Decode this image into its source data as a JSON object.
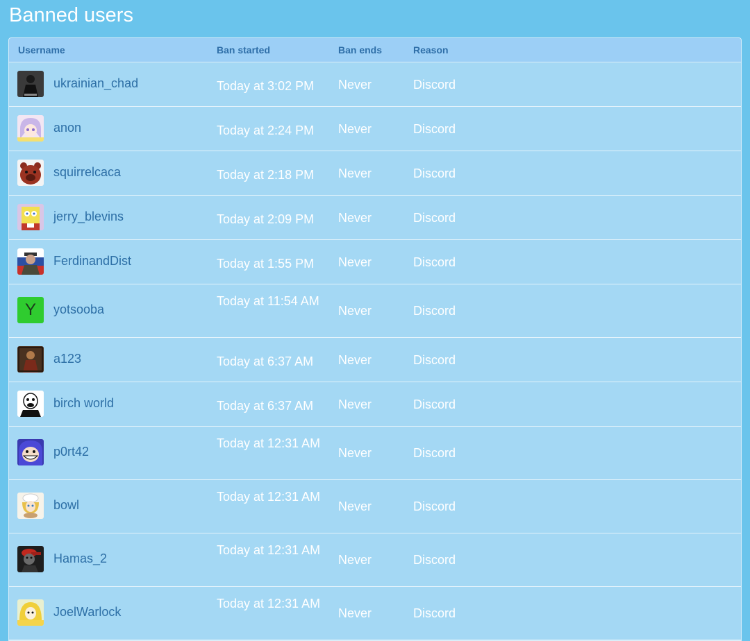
{
  "page": {
    "title": "Banned users"
  },
  "table": {
    "headers": {
      "username": "Username",
      "ban_started": "Ban started",
      "ban_ends": "Ban ends",
      "reason": "Reason"
    },
    "rows": [
      {
        "username": "ukrainian_chad",
        "ban_started": "Today at 3:02 PM",
        "ban_ends": "Never",
        "reason": "Discord",
        "avatar": "dark-figure-avatar"
      },
      {
        "username": "anon",
        "ban_started": "Today at 2:24 PM",
        "ban_ends": "Never",
        "reason": "Discord",
        "avatar": "anime-girl-avatar"
      },
      {
        "username": "squirrelcaca",
        "ban_started": "Today at 2:18 PM",
        "ban_ends": "Never",
        "reason": "Discord",
        "avatar": "red-bear-avatar"
      },
      {
        "username": "jerry_blevins",
        "ban_started": "Today at 2:09 PM",
        "ban_ends": "Never",
        "reason": "Discord",
        "avatar": "cartoon-sponge-avatar"
      },
      {
        "username": "FerdinandDist",
        "ban_started": "Today at 1:55 PM",
        "ban_ends": "Never",
        "reason": "Discord",
        "avatar": "soldier-flag-avatar"
      },
      {
        "username": "yotsooba",
        "ban_started": "Today at 11:54 AM",
        "ban_ends": "Never",
        "reason": "Discord",
        "avatar": "letter-avatar",
        "avatar_letter": "Y"
      },
      {
        "username": "a123",
        "ban_started": "Today at 6:37 AM",
        "ban_ends": "Never",
        "reason": "Discord",
        "avatar": "painting-avatar"
      },
      {
        "username": "birch world",
        "ban_started": "Today at 6:37 AM",
        "ban_ends": "Never",
        "reason": "Discord",
        "avatar": "wojak-avatar"
      },
      {
        "username": "p0rt42",
        "ban_started": "Today at 12:31 AM",
        "ban_ends": "Never",
        "reason": "Discord",
        "avatar": "troll-face-avatar"
      },
      {
        "username": "bowl",
        "ban_started": "Today at 12:31 AM",
        "ban_ends": "Never",
        "reason": "Discord",
        "avatar": "chef-girl-avatar"
      },
      {
        "username": "Hamas_2",
        "ban_started": "Today at 12:31 AM",
        "ban_ends": "Never",
        "reason": "Discord",
        "avatar": "red-cap-avatar"
      },
      {
        "username": "JoelWarlock",
        "ban_started": "Today at 12:31 AM",
        "ban_ends": "Never",
        "reason": "Discord",
        "avatar": "yellow-hood-avatar"
      }
    ]
  },
  "colors": {
    "background": "#6ac4ec",
    "table_row": "#a4d8f4",
    "header_row": "#9ccff6",
    "header_text": "#2f6fa8",
    "username_link": "#2d6fa6",
    "cell_text": "#ffffff",
    "letter_avatar": "#2fcc2f"
  }
}
